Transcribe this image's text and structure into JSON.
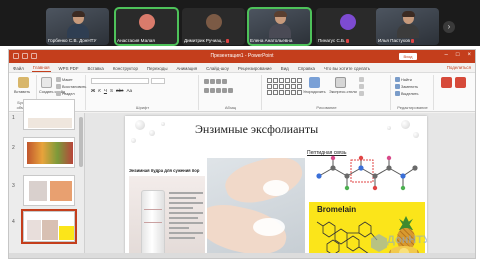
{
  "participants": [
    {
      "name": "Горбенко С.В. ДонНТУ",
      "avatar_color": "",
      "muted": false,
      "video": true,
      "active": false
    },
    {
      "name": "Анастасия Малая",
      "avatar_color": "#d97b6b",
      "muted": false,
      "video": false,
      "active": true
    },
    {
      "name": "Димитрик Ручиац...",
      "avatar_color": "#7b5a45",
      "muted": true,
      "video": false,
      "active": false
    },
    {
      "name": "Елена Анатольевна",
      "avatar_color": "",
      "muted": false,
      "video": true,
      "active": true
    },
    {
      "name": "Пинагус С.Б.",
      "avatar_color": "#7d4bd1",
      "muted": true,
      "video": false,
      "active": false
    },
    {
      "name": "Илья Пастухов",
      "avatar_color": "",
      "muted": true,
      "video": true,
      "active": false
    }
  ],
  "ppt": {
    "title": "Презентация1 - PowerPoint",
    "signin": "Вход",
    "tabs": [
      "Файл",
      "Главная",
      "WPS PDF",
      "Вставка",
      "Конструктор",
      "Переходы",
      "Анимация",
      "Слайд-шоу",
      "Рецензирование",
      "Вид",
      "Справка",
      "Что вы хотите сделать"
    ],
    "active_tab": "Главная",
    "share": "Поделиться",
    "groups": [
      "Буфер обмена",
      "Слайды",
      "Шрифт",
      "Абзац",
      "Рисование",
      "Редактирование"
    ],
    "buttons": {
      "paste": "Вставить",
      "new_slide": "Создать слайд",
      "layout": "Макет",
      "reset": "Восстановить",
      "section": "Раздел",
      "arrange": "Упорядочить",
      "quick_styles": "Экспресс-стили",
      "find": "Найти",
      "replace": "Заменить",
      "select": "Выделить"
    },
    "format_glyphs": [
      "Ж",
      "К",
      "Ч",
      "S",
      "abc",
      "Aa"
    ]
  },
  "slides": [
    {
      "num": "1"
    },
    {
      "num": "2"
    },
    {
      "num": "3"
    },
    {
      "num": "4"
    }
  ],
  "slide": {
    "title": "Энзимные эксфолианты",
    "peptide_label": "Пептидная связь",
    "product_caption": "Энзимная пудра для сужения пор",
    "bromelain_label": "Bromelain",
    "watermark": "ДонНТУ",
    "colors": {
      "ppt_accent": "#c43e1c",
      "bromelain_bg": "#fbe51a",
      "zoom_active_border": "#4ec25a"
    }
  }
}
